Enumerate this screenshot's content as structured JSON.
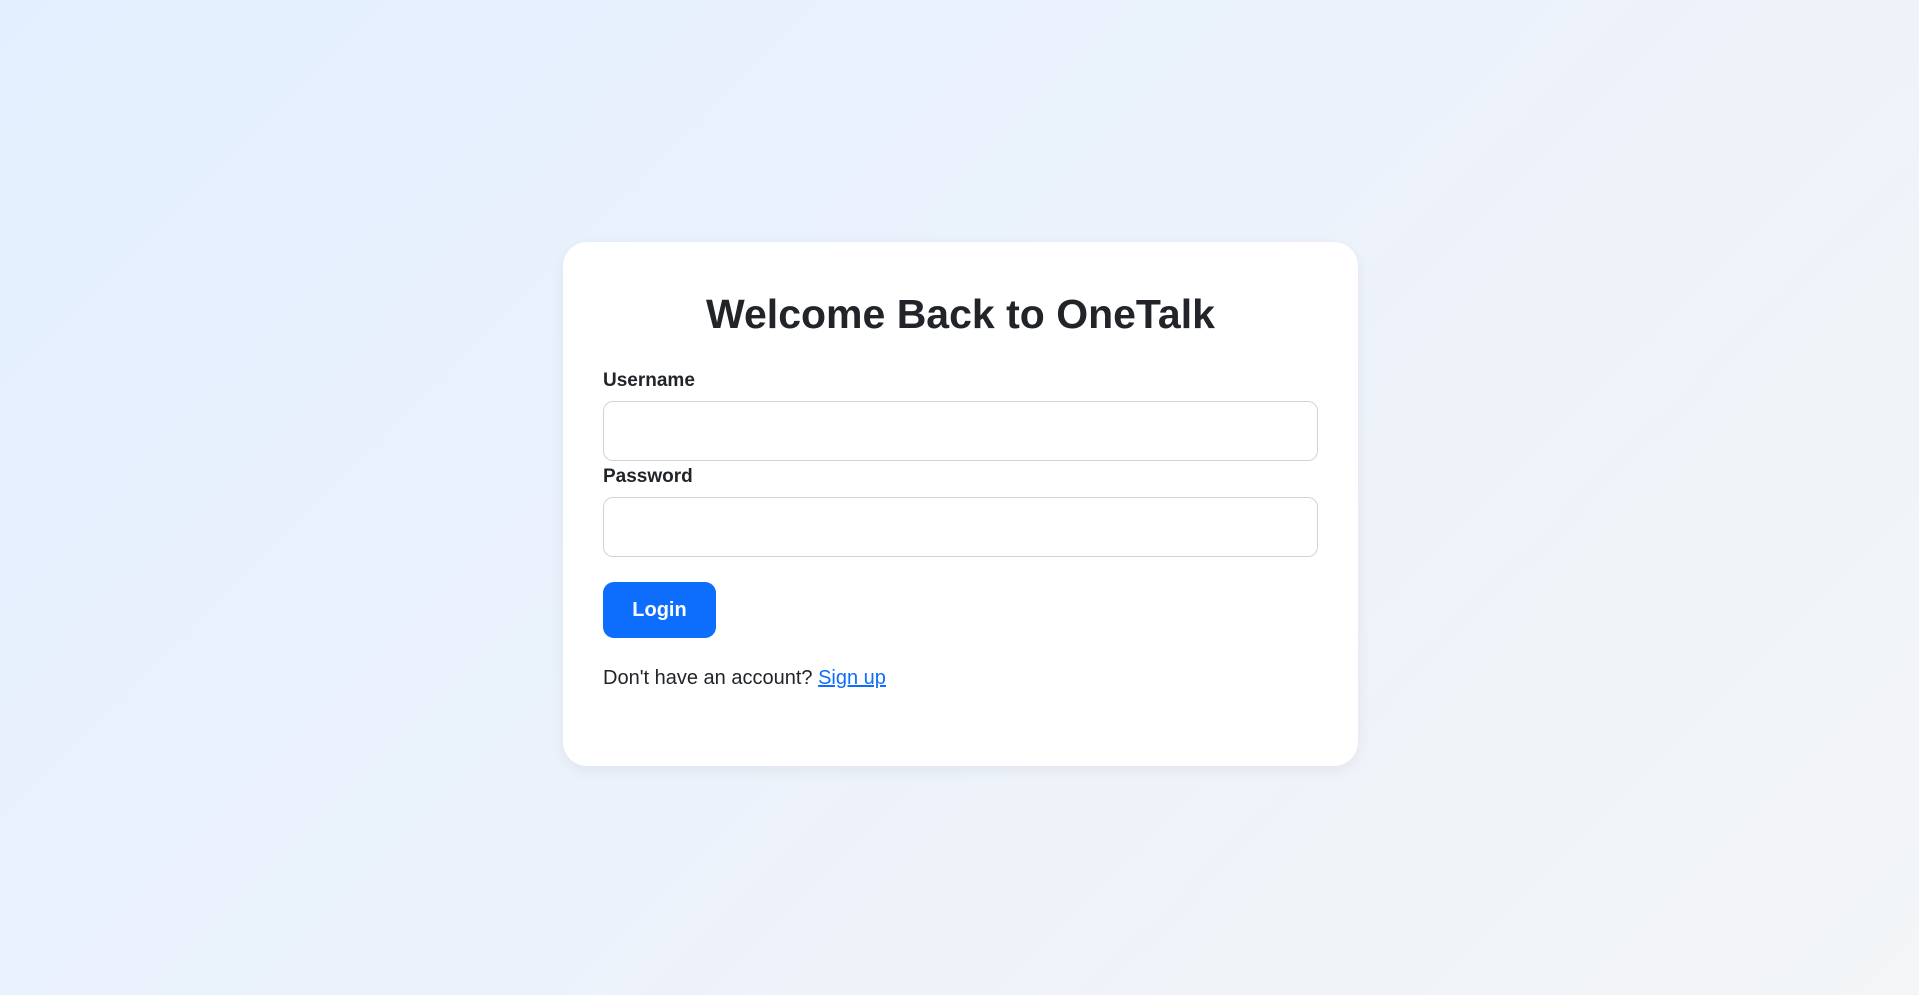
{
  "login_card": {
    "title": "Welcome Back to OneTalk",
    "username": {
      "label": "Username",
      "value": "",
      "placeholder": ""
    },
    "password": {
      "label": "Password",
      "value": "",
      "placeholder": ""
    },
    "login_button_label": "Login",
    "signup_prompt": "Don't have an account?",
    "signup_link_label": "Sign up"
  },
  "colors": {
    "accent": "#0d6efd",
    "card_background": "#ffffff",
    "text": "#212529",
    "input_border": "#ced4da"
  }
}
